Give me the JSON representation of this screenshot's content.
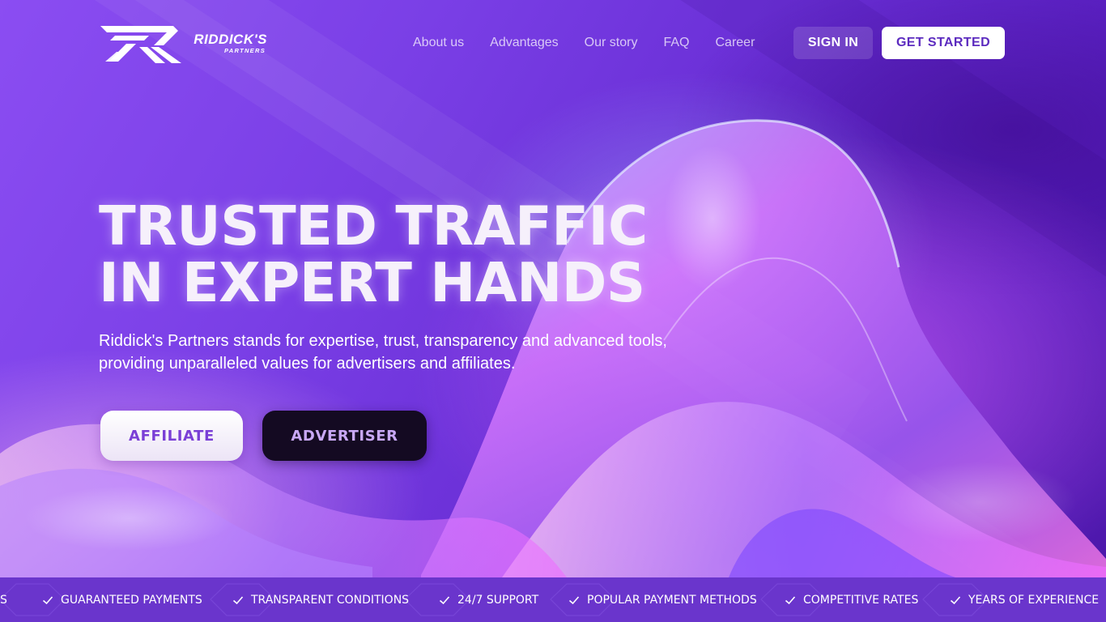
{
  "brand": {
    "name": "RIDDICK'S",
    "subtitle": "PARTNERS"
  },
  "nav": {
    "items": [
      {
        "label": "About us"
      },
      {
        "label": "Advantages"
      },
      {
        "label": "Our story"
      },
      {
        "label": "FAQ"
      },
      {
        "label": "Career"
      }
    ],
    "signin_label": "SIGN IN",
    "get_started_label": "GET STARTED"
  },
  "hero": {
    "title_line1": "TRUSTED TRAFFIC",
    "title_line2": "IN EXPERT HANDS",
    "description_line1": "Riddick's Partners stands for expertise, trust, transparency and advanced tools,",
    "description_line2": "providing unparalleled values for advertisers and affiliates.",
    "affiliate_label": "AFFILIATE",
    "advertiser_label": "ADVERTISER"
  },
  "ticker": {
    "partial_label": "S",
    "items": [
      {
        "label": "GUARANTEED PAYMENTS",
        "icon": "check-icon"
      },
      {
        "label": "TRANSPARENT CONDITIONS",
        "icon": "check-icon"
      },
      {
        "label": "24/7 SUPPORT",
        "icon": "check-icon"
      },
      {
        "label": "POPULAR PAYMENT METHODS",
        "icon": "check-icon"
      },
      {
        "label": "COMPETITIVE RATES",
        "icon": "check-icon"
      },
      {
        "label": "YEARS OF EXPERIENCE",
        "icon": "check-icon"
      }
    ]
  },
  "colors": {
    "background_primary": "#7a3fe6",
    "accent_text": "#5c2bbf",
    "advertiser_button": "#140a22",
    "ticker_background": "#6a35cc"
  }
}
